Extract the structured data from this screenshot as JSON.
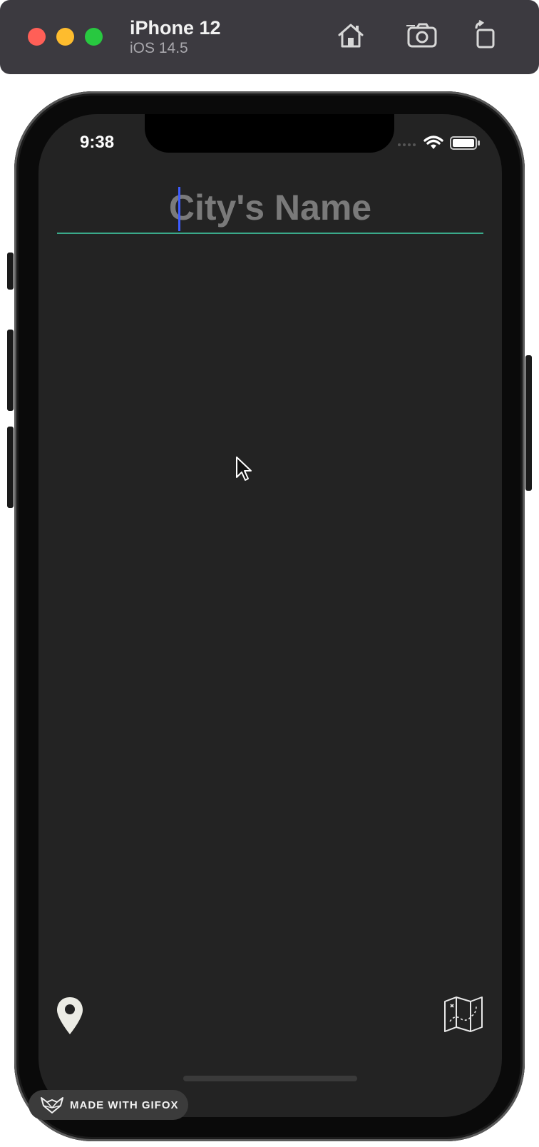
{
  "simulator": {
    "device_name": "iPhone 12",
    "os_version": "iOS 14.5",
    "icons": [
      "home-icon",
      "screenshot-icon",
      "rotate-icon"
    ]
  },
  "status_bar": {
    "time": "9:38",
    "icons": [
      "signal-icon",
      "wifi-icon",
      "battery-icon"
    ]
  },
  "search": {
    "placeholder": "City's Name",
    "value": ""
  },
  "bottom_bar": {
    "left_icon": "location-pin-icon",
    "right_icon": "map-icon"
  },
  "watermark": {
    "text": "MADE WITH GIFOX"
  },
  "colors": {
    "background": "#232323",
    "input_underline": "#3aa98a",
    "caret": "#3d5cff",
    "placeholder": "#7a7a7a"
  }
}
